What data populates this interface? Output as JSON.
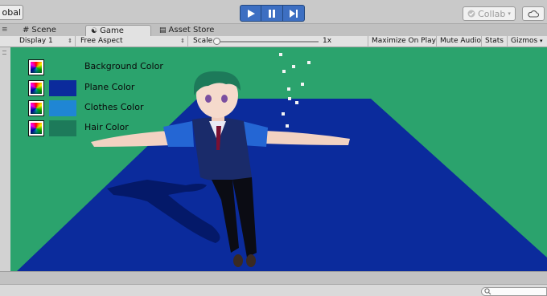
{
  "toolbar": {
    "global_label": "obal",
    "collab_label": "Collab",
    "play_icons": [
      "play-icon",
      "pause-icon",
      "step-icon"
    ],
    "accent": "#3d6fc2"
  },
  "tabs": [
    {
      "label": "Scene",
      "icon": "scene-icon",
      "active": false
    },
    {
      "label": "Game",
      "icon": "game-icon",
      "active": true
    },
    {
      "label": "Asset Store",
      "icon": "asset-store-icon",
      "active": false
    }
  ],
  "gamebar": {
    "display": "Display 1",
    "aspect": "Free Aspect",
    "scale_label": "Scale",
    "scale_value": "1x",
    "maximize": "Maximize On Play",
    "mute": "Mute Audio",
    "stats": "Stats",
    "gizmos": "Gizmos"
  },
  "colors": {
    "background": "#2ba36d",
    "plane": "#0b2b9c",
    "clothes": "#1f86d4",
    "hair": "#1d7a5a"
  },
  "color_items": [
    {
      "label": "Background Color",
      "swatch": ""
    },
    {
      "label": "Plane Color",
      "swatch": "#0b2b9c"
    },
    {
      "label": "Clothes Color",
      "swatch": "#1f86d4"
    },
    {
      "label": "Hair Color",
      "swatch": "#1d7a5a"
    }
  ]
}
